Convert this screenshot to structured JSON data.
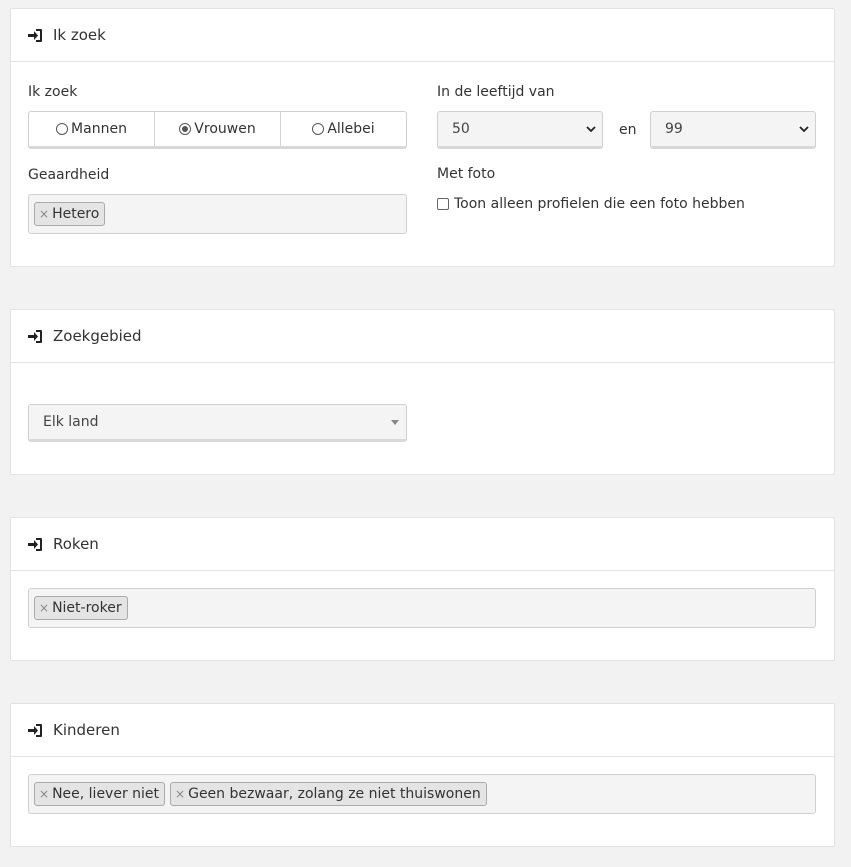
{
  "sections": {
    "ik_zoek": {
      "title": "Ik zoek",
      "seeking_label": "Ik zoek",
      "gender_options": [
        "Mannen",
        "Vrouwen",
        "Allebei"
      ],
      "gender_selected": "Vrouwen",
      "age_label": "In de leeftijd van",
      "age_min": "50",
      "age_separator": "en",
      "age_max": "99",
      "orientation_label": "Geaardheid",
      "orientation_tags": [
        "Hetero"
      ],
      "photo_label": "Met foto",
      "photo_checkbox_label": "Toon alleen profielen die een foto hebben",
      "photo_checked": false
    },
    "zoekgebied": {
      "title": "Zoekgebied",
      "country_value": "Elk land"
    },
    "roken": {
      "title": "Roken",
      "tags": [
        "Niet-roker"
      ]
    },
    "kinderen": {
      "title": "Kinderen",
      "tags": [
        "Nee, liever niet",
        "Geen bezwaar, zolang ze niet thuiswonen"
      ]
    }
  },
  "icons": {
    "section_icon": "sign-in-icon"
  },
  "tag_remove_symbol": "×"
}
